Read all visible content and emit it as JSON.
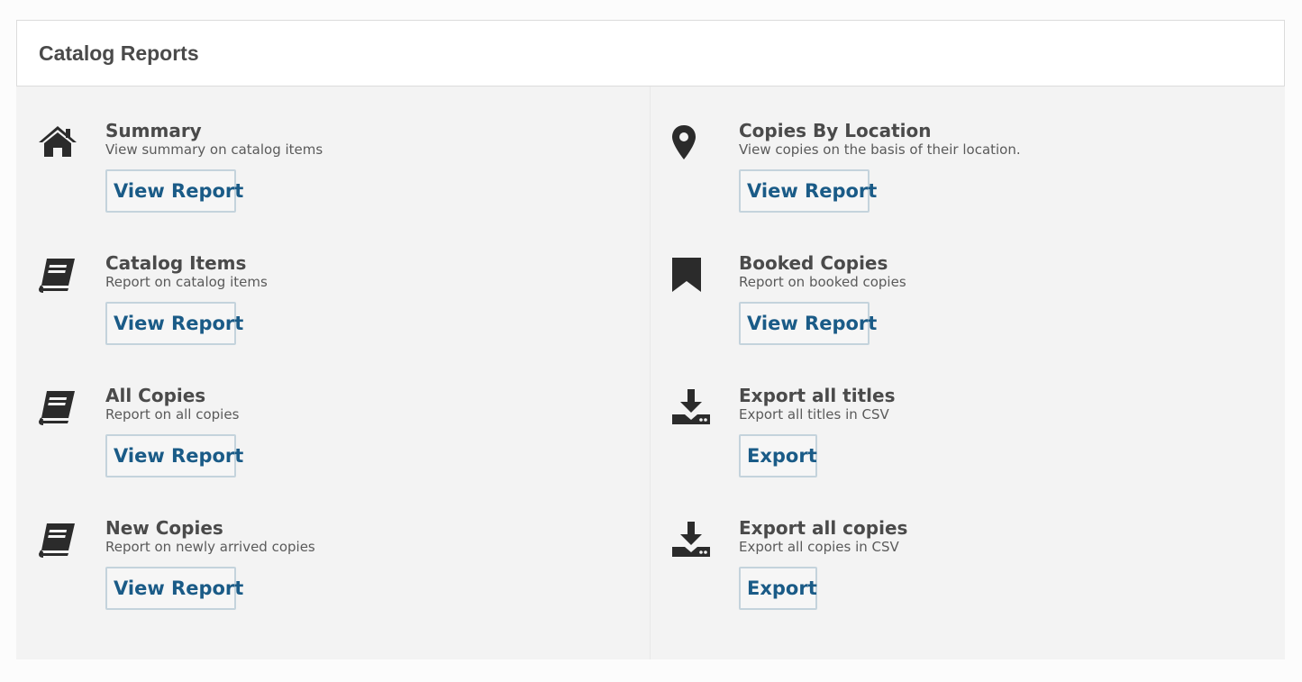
{
  "panel": {
    "title": "Catalog Reports"
  },
  "colors": {
    "button_text": "#1a5b87",
    "button_border": "#c4d3dc",
    "panel_bg": "#f3f3f3",
    "icon": "#2b2b2b"
  },
  "reports": {
    "left": [
      {
        "icon": "home-icon",
        "title": "Summary",
        "description": "View summary on catalog items",
        "button": "View Report"
      },
      {
        "icon": "book-icon",
        "title": "Catalog Items",
        "description": "Report on catalog items",
        "button": "View Report"
      },
      {
        "icon": "book-icon",
        "title": "All Copies",
        "description": "Report on all copies",
        "button": "View Report"
      },
      {
        "icon": "book-icon",
        "title": "New Copies",
        "description": "Report on newly arrived copies",
        "button": "View Report"
      }
    ],
    "right": [
      {
        "icon": "map-marker-icon",
        "title": "Copies By Location",
        "description": "View copies on the basis of their location.",
        "button": "View Report"
      },
      {
        "icon": "bookmark-icon",
        "title": "Booked Copies",
        "description": "Report on booked copies",
        "button": "View Report"
      },
      {
        "icon": "download-icon",
        "title": "Export all titles",
        "description": "Export all titles in CSV",
        "button": "Export"
      },
      {
        "icon": "download-icon",
        "title": "Export all copies",
        "description": "Export all copies in CSV",
        "button": "Export"
      }
    ]
  }
}
